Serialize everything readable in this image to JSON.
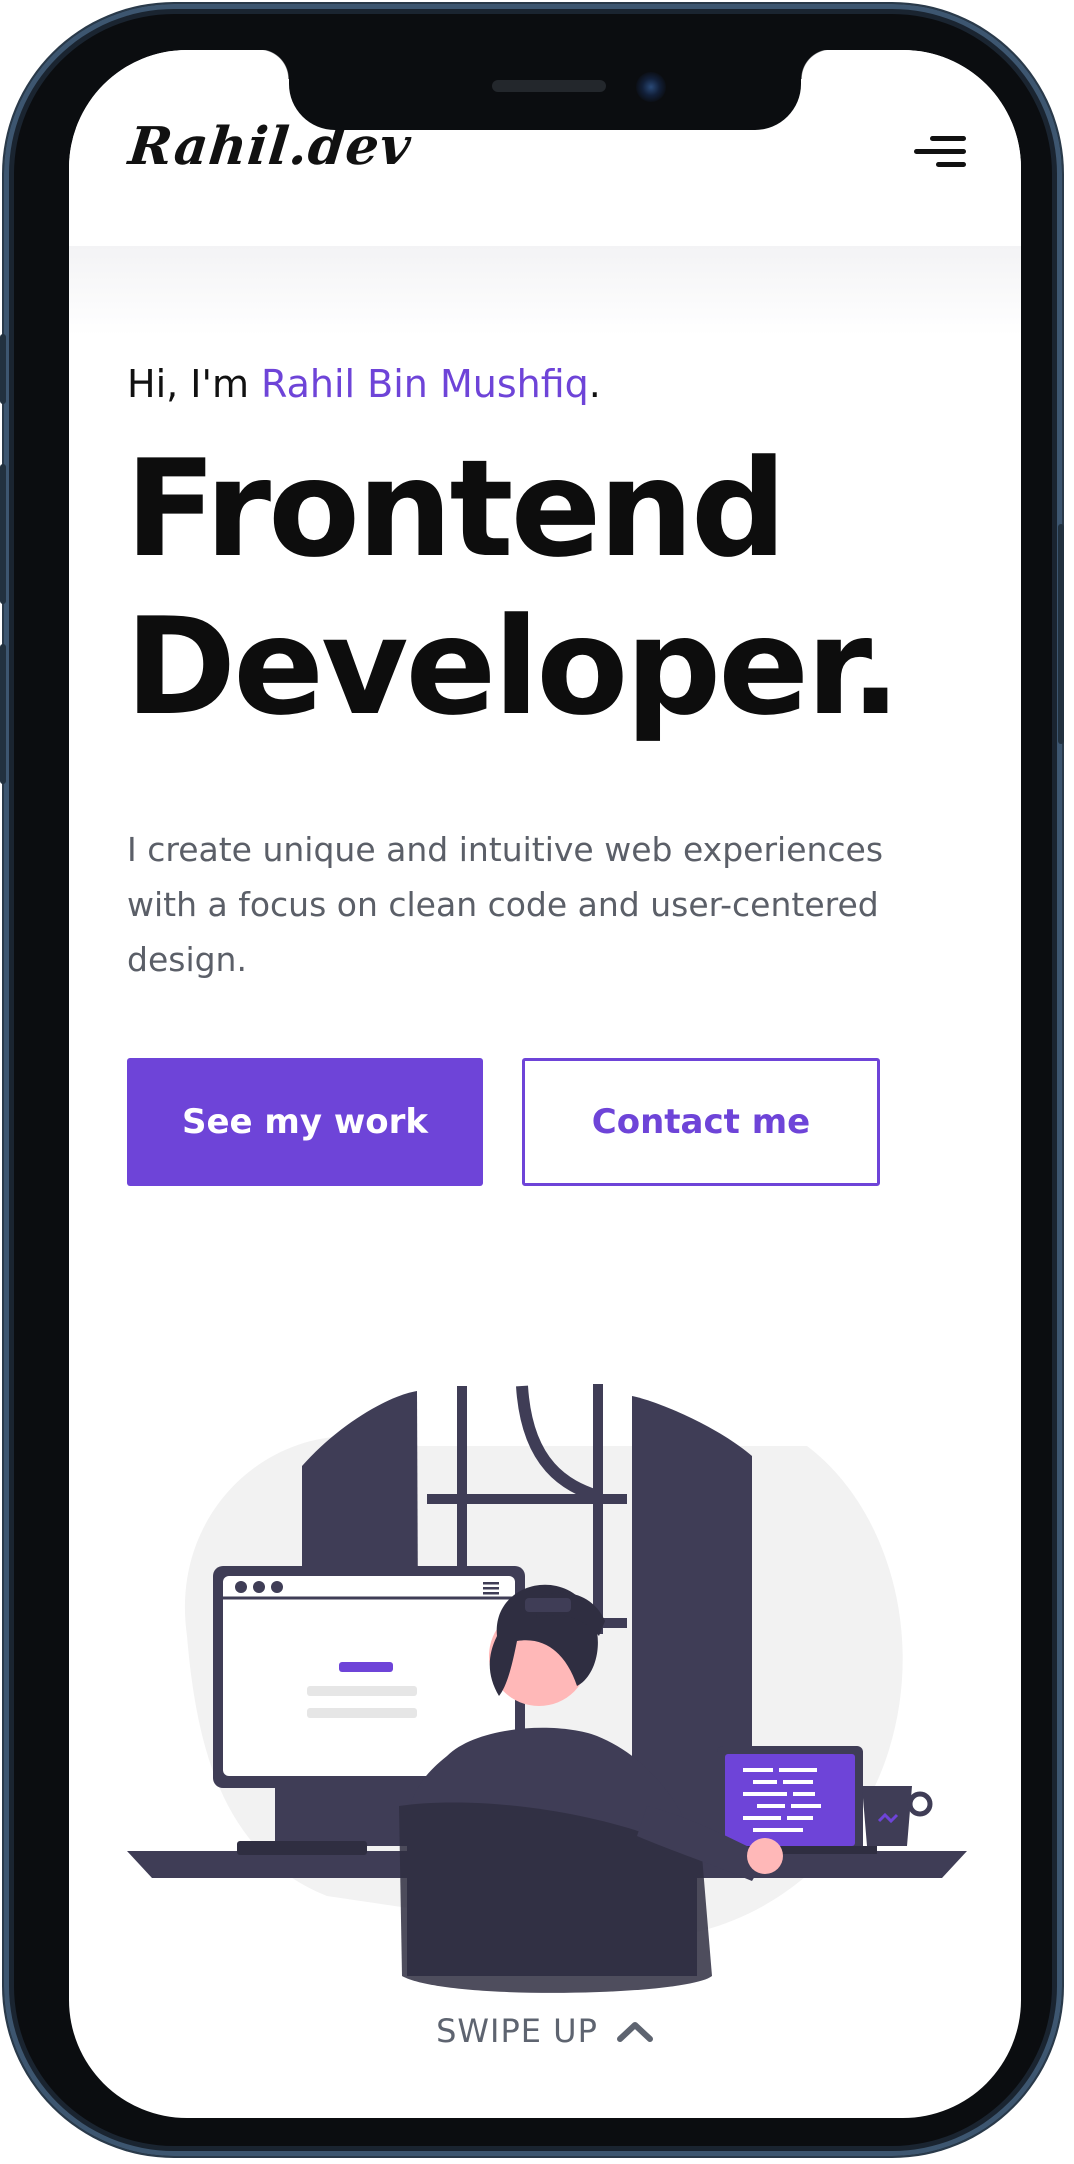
{
  "header": {
    "logo": "Rahil.dev",
    "menu_icon": "hamburger-menu-icon"
  },
  "hero": {
    "greeting_prefix": "Hi, I'm ",
    "name": "Rahil Bin Mushfiq",
    "greeting_suffix": ".",
    "headline_line1": "Frontend",
    "headline_line2": "Developer.",
    "intro": "I create unique and intuitive web experiences with a focus on clean code and user-centered design.",
    "primary_button": "See my work",
    "secondary_button": "Contact me"
  },
  "illustration": {
    "icon": "developer-at-desk-illustration"
  },
  "footer": {
    "swipe_label": "SWIPE UP",
    "swipe_icon": "chevron-up-icon"
  },
  "colors": {
    "accent": "#6e44d8",
    "text_dark": "#0d0d0d",
    "text_muted": "#5b5f68",
    "illustration_dark": "#3f3d56",
    "frame": "#0b0d10"
  }
}
